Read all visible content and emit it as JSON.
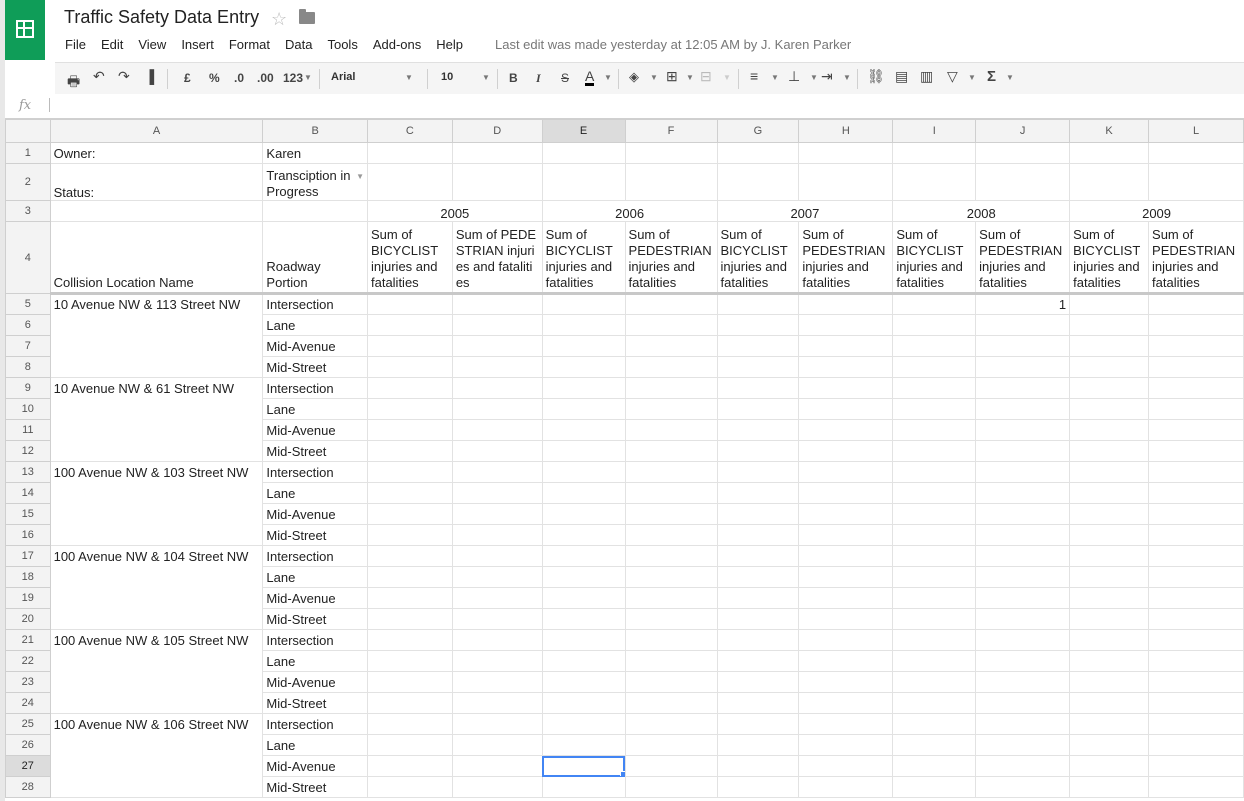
{
  "app": {
    "title": "Traffic Safety Data Entry",
    "star_icon": "☆",
    "last_edit": "Last edit was made yesterday at 12:05 AM by J. Karen Parker",
    "accent_color": "#0f9d58"
  },
  "menu": [
    "File",
    "Edit",
    "View",
    "Insert",
    "Format",
    "Data",
    "Tools",
    "Add-ons",
    "Help"
  ],
  "toolbar": {
    "currency": "£",
    "percent": "%",
    "dec_decrease": ".0",
    "dec_increase": ".00",
    "more_formats": "123",
    "font": "Arial",
    "font_size": "10",
    "bold": "B",
    "italic": "I",
    "strike": "S",
    "text_color": "A",
    "functions": "Σ"
  },
  "formula_bar": {
    "fx_label": "fx",
    "value": ""
  },
  "sheet": {
    "columns": [
      "A",
      "B",
      "C",
      "D",
      "E",
      "F",
      "G",
      "H",
      "I",
      "J",
      "K",
      "L"
    ],
    "selected_column": "E",
    "selected_row": "27",
    "owner_label": "Owner:",
    "owner_value": "Karen",
    "status_label": "Status:",
    "status_value": "Transciption in Progress",
    "years": [
      "2005",
      "2006",
      "2007",
      "2008",
      "2009"
    ],
    "header_location": "Collision Location Name",
    "header_roadway": "Roadway Portion",
    "header_bicyclist": "Sum of BICYCLIST injuries and fatalities",
    "header_pedestrian": "Sum of PEDESTRIAN injuries and fatalities",
    "row_numbers": [
      "1",
      "2",
      "3",
      "4",
      "5",
      "6",
      "7",
      "8",
      "9",
      "10",
      "11",
      "12",
      "13",
      "14",
      "15",
      "16",
      "17",
      "18",
      "19",
      "20",
      "21",
      "22",
      "23",
      "24",
      "25",
      "26",
      "27",
      "28"
    ],
    "locations": [
      "10 Avenue NW & 113 Street NW",
      "10 Avenue NW & 61 Street NW",
      "100 Avenue NW & 103 Street NW",
      "100 Avenue NW & 104 Street NW",
      "100 Avenue NW & 105 Street NW",
      "100 Avenue NW & 106 Street NW"
    ],
    "portions": [
      "Intersection",
      "Lane",
      "Mid-Avenue",
      "Mid-Street"
    ],
    "cell_J5": "1"
  }
}
